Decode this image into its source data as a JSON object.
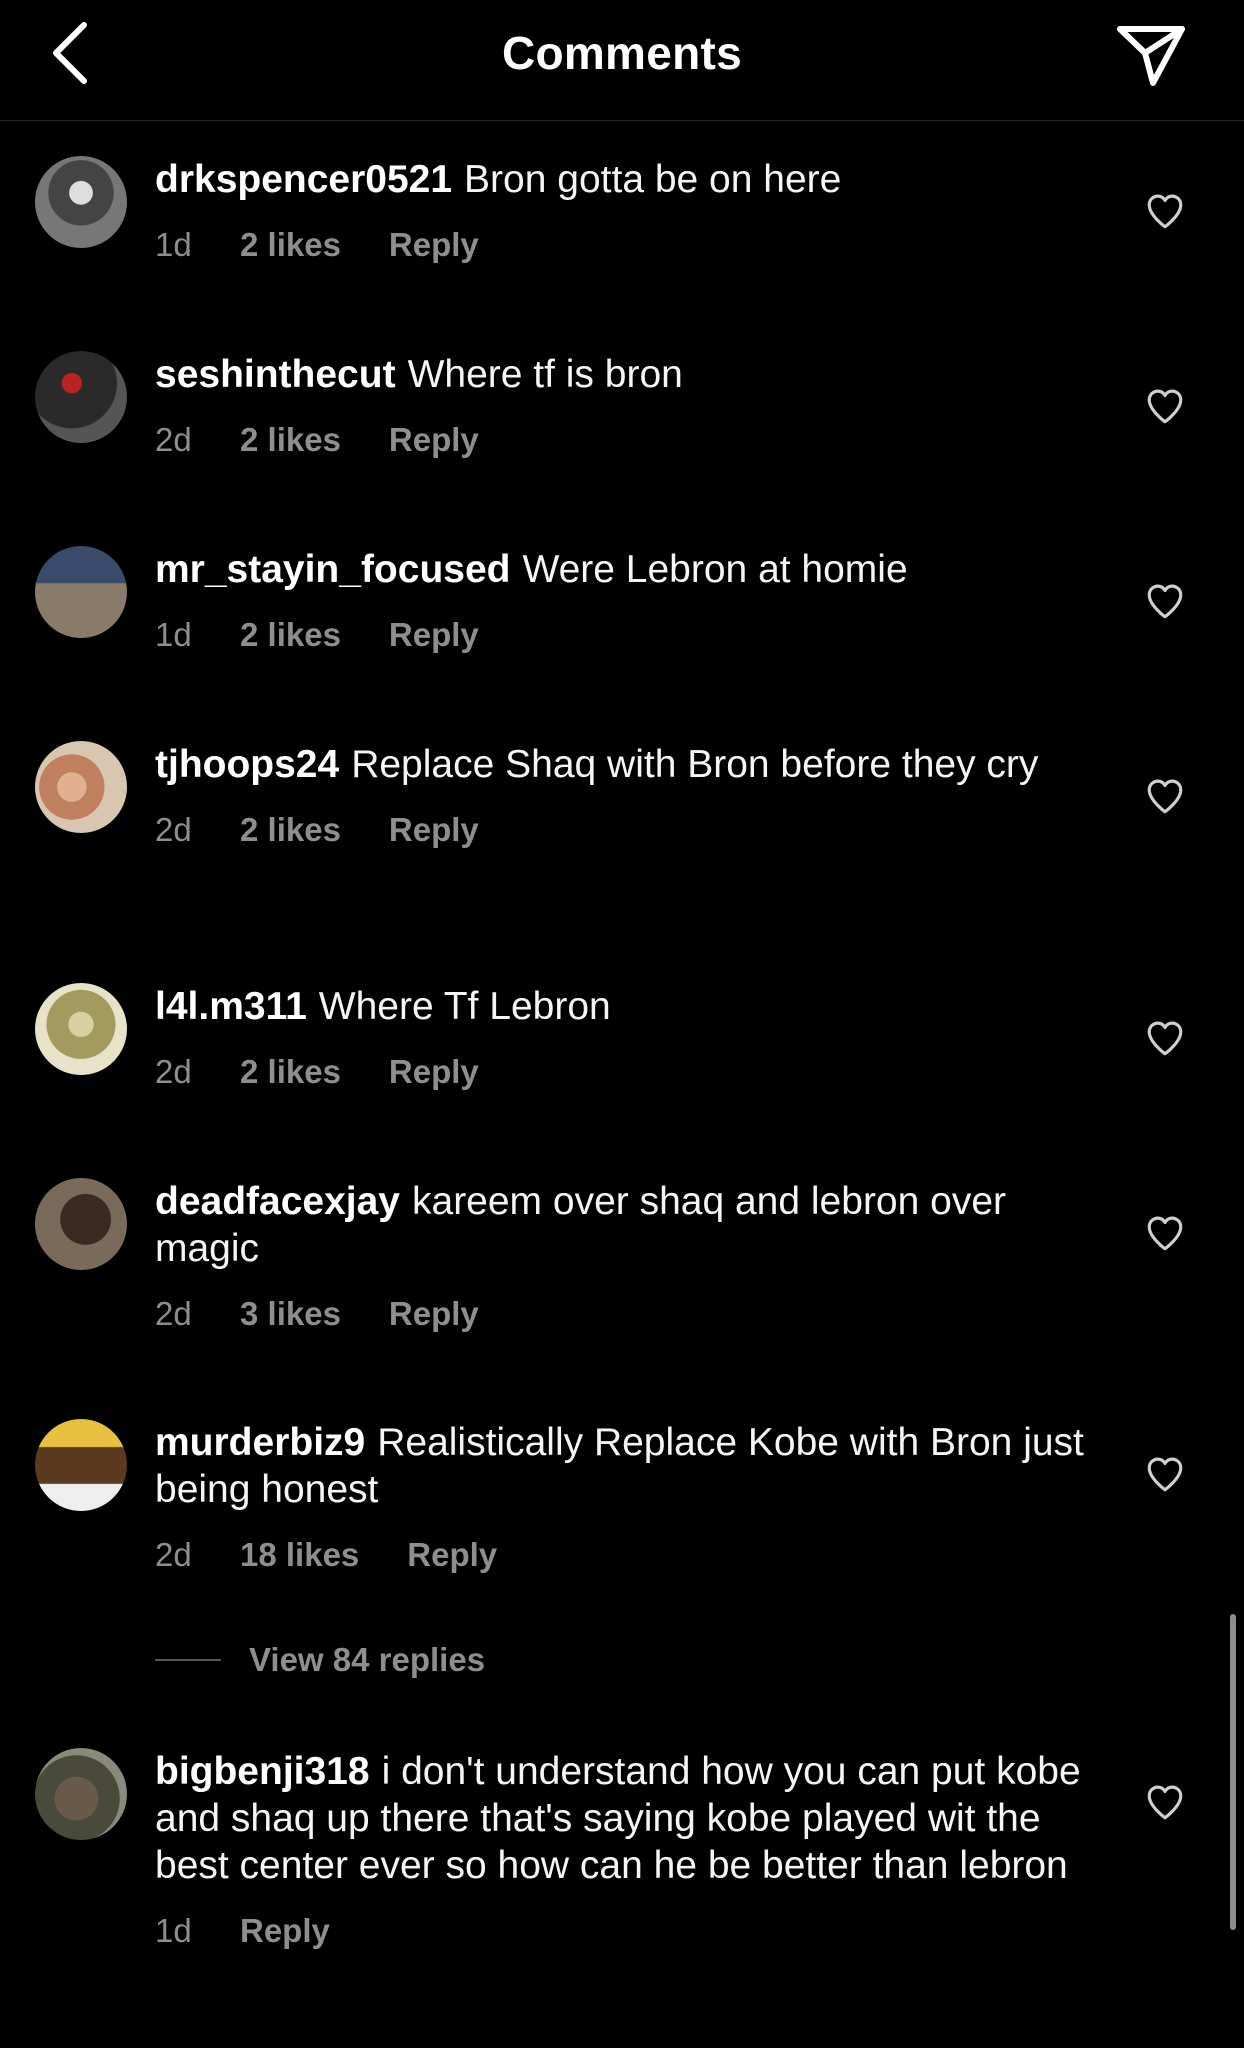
{
  "header": {
    "title": "Comments",
    "back_icon": "chevron-left-icon",
    "send_icon": "paper-plane-icon"
  },
  "comments": [
    {
      "username": "drkspencer0521",
      "text": "Bron gotta be on here",
      "time": "1d",
      "likes": "2 likes",
      "reply": "Reply"
    },
    {
      "username": "seshinthecut",
      "text": "Where tf is bron",
      "time": "2d",
      "likes": "2 likes",
      "reply": "Reply"
    },
    {
      "username": "mr_stayin_focused",
      "text": "Were Lebron at homie",
      "time": "1d",
      "likes": "2 likes",
      "reply": "Reply"
    },
    {
      "username": "tjhoops24",
      "text": "Replace Shaq with Bron before they cry",
      "time": "2d",
      "likes": "2 likes",
      "reply": "Reply"
    },
    {
      "username": "l4l.m311",
      "text": "Where Tf Lebron",
      "time": "2d",
      "likes": "2 likes",
      "reply": "Reply"
    },
    {
      "username": "deadfacexjay",
      "text": "kareem over shaq and lebron over magic",
      "time": "2d",
      "likes": "3 likes",
      "reply": "Reply"
    },
    {
      "username": "murderbiz9",
      "text": "Realistically Replace Kobe with Bron just being honest",
      "time": "2d",
      "likes": "18 likes",
      "reply": "Reply"
    },
    {
      "username": "bigbenji318",
      "text": "i don't understand how you can put kobe and shaq up there that's saying kobe played wit the best center ever so how can he be better than lebron",
      "time": "1d",
      "likes": "",
      "reply": "Reply"
    }
  ],
  "view_replies": {
    "label": "View 84 replies"
  },
  "colors": {
    "background": "#000000",
    "text": "#ffffff",
    "secondary": "#8e8e8e"
  }
}
